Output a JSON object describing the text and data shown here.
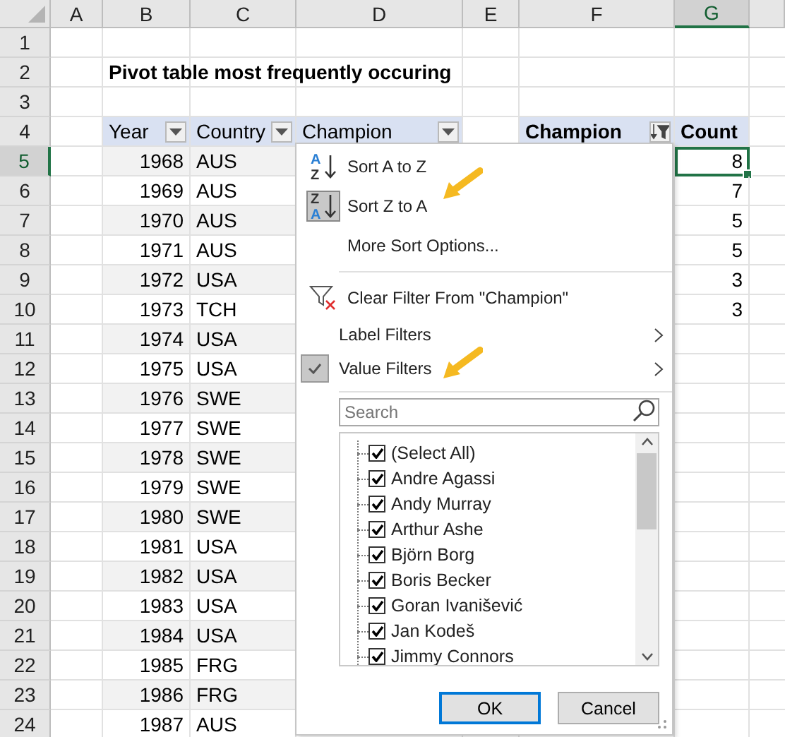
{
  "sheet": {
    "columns": [
      {
        "label": "A",
        "selected": false
      },
      {
        "label": "B",
        "selected": false
      },
      {
        "label": "C",
        "selected": false
      },
      {
        "label": "D",
        "selected": false
      },
      {
        "label": "E",
        "selected": false
      },
      {
        "label": "F",
        "selected": false
      },
      {
        "label": "G",
        "selected": true
      }
    ],
    "row_numbers": [
      {
        "label": "1",
        "selected": false
      },
      {
        "label": "2",
        "selected": false
      },
      {
        "label": "3",
        "selected": false
      },
      {
        "label": "4",
        "selected": false
      },
      {
        "label": "5",
        "selected": true
      },
      {
        "label": "6",
        "selected": false
      },
      {
        "label": "7",
        "selected": false
      },
      {
        "label": "8",
        "selected": false
      },
      {
        "label": "9",
        "selected": false
      },
      {
        "label": "10",
        "selected": false
      },
      {
        "label": "11",
        "selected": false
      },
      {
        "label": "12",
        "selected": false
      },
      {
        "label": "13",
        "selected": false
      },
      {
        "label": "14",
        "selected": false
      },
      {
        "label": "15",
        "selected": false
      },
      {
        "label": "16",
        "selected": false
      },
      {
        "label": "17",
        "selected": false
      },
      {
        "label": "18",
        "selected": false
      },
      {
        "label": "19",
        "selected": false
      },
      {
        "label": "20",
        "selected": false
      },
      {
        "label": "21",
        "selected": false
      },
      {
        "label": "22",
        "selected": false
      },
      {
        "label": "23",
        "selected": false
      },
      {
        "label": "24",
        "selected": false
      }
    ],
    "title": "Pivot table most frequently occuring",
    "table": {
      "headers": [
        "Year",
        "Country",
        "Champion"
      ],
      "rows": [
        {
          "year": "1968",
          "country": "AUS"
        },
        {
          "year": "1969",
          "country": "AUS"
        },
        {
          "year": "1970",
          "country": "AUS"
        },
        {
          "year": "1971",
          "country": "AUS"
        },
        {
          "year": "1972",
          "country": "USA"
        },
        {
          "year": "1973",
          "country": "TCH"
        },
        {
          "year": "1974",
          "country": "USA"
        },
        {
          "year": "1975",
          "country": "USA"
        },
        {
          "year": "1976",
          "country": "SWE"
        },
        {
          "year": "1977",
          "country": "SWE"
        },
        {
          "year": "1978",
          "country": "SWE"
        },
        {
          "year": "1979",
          "country": "SWE"
        },
        {
          "year": "1980",
          "country": "SWE"
        },
        {
          "year": "1981",
          "country": "USA"
        },
        {
          "year": "1982",
          "country": "USA"
        },
        {
          "year": "1983",
          "country": "USA"
        },
        {
          "year": "1984",
          "country": "USA"
        },
        {
          "year": "1985",
          "country": "FRG"
        },
        {
          "year": "1986",
          "country": "FRG"
        },
        {
          "year": "1987",
          "country": "AUS"
        }
      ]
    },
    "pivot": {
      "row_header": "Champion",
      "value_header": "Count",
      "counts": [
        {
          "value": "8",
          "selected": true
        },
        {
          "value": "7",
          "selected": false
        },
        {
          "value": "5",
          "selected": false
        },
        {
          "value": "5",
          "selected": false
        },
        {
          "value": "3",
          "selected": false
        },
        {
          "value": "3",
          "selected": false
        }
      ]
    }
  },
  "filter_menu": {
    "items": [
      {
        "kind": "sort",
        "icon_text": [
          "A",
          "Z"
        ],
        "label": "Sort A to Z",
        "selected": false,
        "pointed": false
      },
      {
        "kind": "sort",
        "icon_text": [
          "Z",
          "A"
        ],
        "label": "Sort Z to A",
        "selected": true,
        "pointed": true
      },
      {
        "kind": "command",
        "label": "More Sort Options...",
        "pointed": false
      },
      {
        "kind": "separator"
      },
      {
        "kind": "clear",
        "label": "Clear Filter From \"Champion\"",
        "pointed": false
      },
      {
        "kind": "submenu",
        "label": "Label Filters",
        "checked": false,
        "pointed": false
      },
      {
        "kind": "submenu",
        "label": "Value Filters",
        "checked": true,
        "pointed": true
      },
      {
        "kind": "separator"
      }
    ],
    "search": {
      "placeholder": "Search"
    },
    "values": [
      {
        "label": "(Select All)",
        "checked": true
      },
      {
        "label": "Andre Agassi",
        "checked": true
      },
      {
        "label": "Andy Murray",
        "checked": true
      },
      {
        "label": "Arthur Ashe",
        "checked": true
      },
      {
        "label": "Björn Borg",
        "checked": true
      },
      {
        "label": "Boris Becker",
        "checked": true
      },
      {
        "label": "Goran Ivanišević",
        "checked": true
      },
      {
        "label": "Jan Kodeš",
        "checked": true
      },
      {
        "label": "Jimmy Connors",
        "checked": true
      }
    ],
    "buttons": [
      {
        "label": "OK",
        "kind": "default"
      },
      {
        "label": "Cancel",
        "kind": "normal"
      }
    ]
  }
}
